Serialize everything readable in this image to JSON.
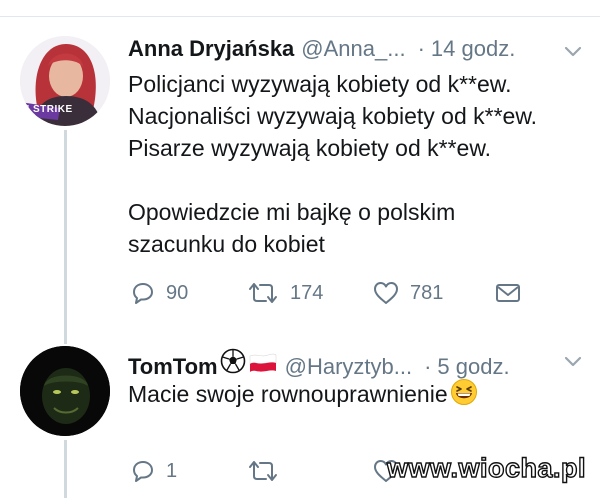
{
  "tweets": [
    {
      "author_name": "Anna Dryjańska",
      "handle": "@Anna_...",
      "separator": "·",
      "time": "14 godz.",
      "avatar_badge": "N STRIKE",
      "text": "Policjanci wyzywają kobiety od k**ew.\nNacjonaliści wyzywają kobiety od k**ew.\nPisarze wyzywają kobiety od k**ew.\n\nOpowiedzcie mi bajkę o polskim\nszacunku do kobiet",
      "replies": "90",
      "retweets": "174",
      "likes": "781"
    },
    {
      "author_name": "TomTom",
      "name_emoji": [
        "soccer-ball",
        "flag-poland"
      ],
      "handle": "@Haryztyb...",
      "separator": "·",
      "time": "5 godz.",
      "text": "Macie swoje rownouprawnienie",
      "text_emoji": "grinning-squinting-face",
      "replies": "1",
      "retweets": "",
      "likes": ""
    }
  ],
  "watermark": "www.wiocha.pl",
  "colors": {
    "text": "#14171a",
    "secondary": "#657786",
    "divider": "#e1e8ed",
    "thread_line": "#cfd9de",
    "badge": "#6b3aa0"
  }
}
